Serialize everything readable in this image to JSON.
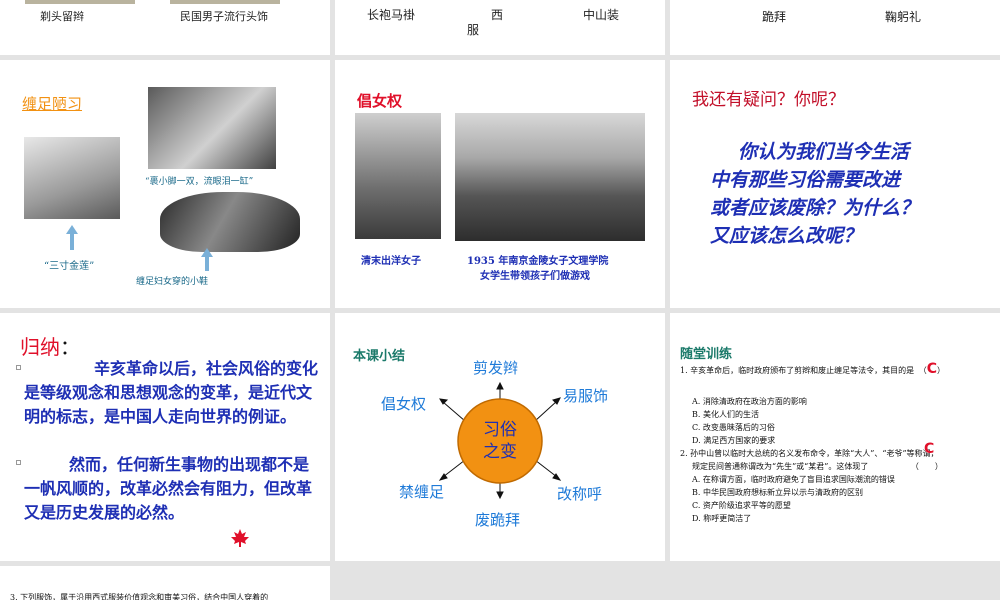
{
  "slide_row1": {
    "left": {
      "caption_a": "剃头留辫",
      "caption_b": "民国男子流行头饰"
    },
    "middle": {
      "caption_a": "长袍马褂",
      "caption_b": "西",
      "caption_b2": "服",
      "caption_c": "中山装"
    },
    "right": {
      "caption_a": "跪拜",
      "caption_b": "鞠躬礼"
    }
  },
  "footbinding": {
    "title": "缠足陋习",
    "quote": "“裹小脚一双，流眼泪一缸”",
    "label_golden_lotus": "“三寸金莲”",
    "label_shoes": "缠足妇女穿的小鞋"
  },
  "women_rights": {
    "title": "倡女权",
    "caption_left": "清末出洋女子",
    "caption_right_line1": "1935 年南京金陵女子文理学院",
    "caption_right_line2": "女学生带领孩子们做游戏"
  },
  "question": {
    "title": "我还有疑问？你呢？",
    "body": [
      "你认为我们当今生活",
      "中有那些习俗需要改进",
      "或者应该废除？为什么？",
      "又应该怎么改呢？"
    ]
  },
  "summary": {
    "title": "归纳",
    "colon": "：",
    "para1": "辛亥革命以后，社会风俗的变化是等级观念和思想观念的变革，是近代文明的标志，是中国人走向世界的例证。",
    "para2": "然而，任何新生事物的出现都不是一帆风顺的，改革必然会有阻力，但改革又是历史发展的必然。"
  },
  "lesson_summary": {
    "title": "本课小结",
    "center": "习俗之变",
    "branches": [
      "剪发辫",
      "易服饰",
      "改称呼",
      "废跪拜",
      "禁缠足",
      "倡女权"
    ]
  },
  "practice": {
    "title": "随堂训练",
    "q1": "1. 辛亥革命后，临时政府颁布了剪辫和废止缠足等法令，其目的是",
    "q1_paren": "（",
    "q1_answer": "C",
    "q1_paren_close": "）",
    "q1_options": [
      "A. 消除清政府在政治方面的影响",
      "B. 美化人们的生活",
      "C. 改变愚昧落后的习俗",
      "D. 满足西方国家的要求"
    ],
    "q2_line1": "2. 孙中山曾以临时大总统的名义发布命令，革除“大人”、“老爷”等称谓，",
    "q2_line2": "规定民间普通称谓改为“先生”或“某君”。这体现了",
    "q2_paren": "（　　）",
    "q2_answer": "C",
    "q2_options": [
      "A. 在称谓方面，临时政府避免了盲目追求国际潮流的错误",
      "B. 中华民国政府想标新立异以示与清政府的区别",
      "C. 资产阶级追求平等的愿望",
      "D. 称呼更简洁了"
    ]
  },
  "bottom_slide": {
    "q3": "3. 下列服饰，属于沿用西式服装价值观念和审美习俗，结合中国人穿着的"
  },
  "colors": {
    "red": "#e0102a",
    "blue": "#1e2fb4",
    "teal": "#1b7a6a",
    "orange": "#f29112"
  }
}
